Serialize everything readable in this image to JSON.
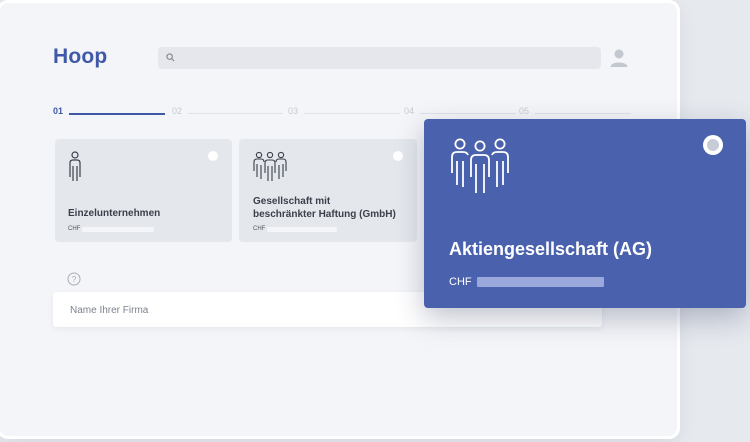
{
  "app": {
    "logo": "Hoop"
  },
  "search": {
    "placeholder": ""
  },
  "stepper": {
    "active_index": 0,
    "steps": [
      "01",
      "02",
      "03",
      "04",
      "05"
    ]
  },
  "legal_forms": [
    {
      "title": "Einzelunternehmen",
      "currency": "CHF",
      "icon": "single-person-icon",
      "selected": false
    },
    {
      "title_line1": "Gesellschaft mit",
      "title_line2": "beschränkter Haftung (GmbH)",
      "currency": "CHF",
      "icon": "group-icon",
      "selected": false
    },
    {
      "title": "Aktiengesellschaft (AG)",
      "currency": "CHF",
      "icon": "large-group-icon",
      "selected": true,
      "highlighted": true
    }
  ],
  "company_name": {
    "placeholder": "Name Ihrer Firma",
    "value": ""
  },
  "colors": {
    "accent": "#3f58a8",
    "highlight_card": "#4a61ad",
    "card_background": "#e4e7ec",
    "page_background": "#f4f5f8"
  }
}
